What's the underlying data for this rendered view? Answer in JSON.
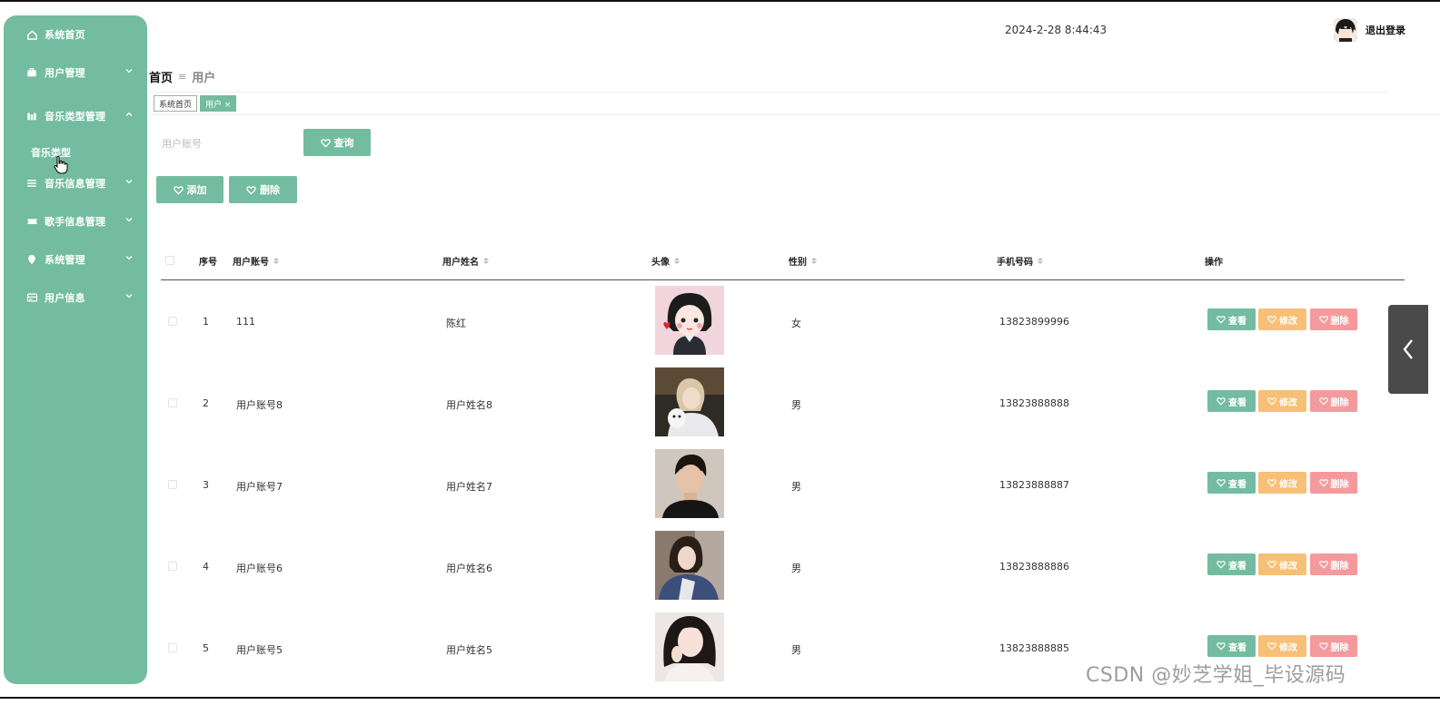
{
  "sidebar": {
    "items": [
      {
        "label": "系统首页",
        "icon": "home-icon"
      },
      {
        "label": "用户管理",
        "icon": "briefcase-icon"
      },
      {
        "label": "音乐类型管理",
        "icon": "bar-chart-icon"
      },
      {
        "label": "音乐信息管理",
        "icon": "list-icon"
      },
      {
        "label": "歌手信息管理",
        "icon": "ticket-icon"
      },
      {
        "label": "系统管理",
        "icon": "location-pin-icon"
      },
      {
        "label": "用户信息",
        "icon": "id-card-icon"
      }
    ],
    "sub_item": "音乐类型"
  },
  "header": {
    "datetime": "2024-2-28 8:44:43",
    "logout": "退出登录"
  },
  "breadcrumb": {
    "home": "首页",
    "separator": "≡",
    "current": "用户"
  },
  "tags": {
    "home": "系统首页",
    "current": "用户 ×"
  },
  "search": {
    "placeholder": "用户账号",
    "query_button": "查询"
  },
  "toolbar": {
    "add": "添加",
    "delete": "删除"
  },
  "table": {
    "columns": [
      "序号",
      "用户账号",
      "用户姓名",
      "头像",
      "性别",
      "手机号码",
      "操作"
    ],
    "rows": [
      {
        "index": "1",
        "account": "111",
        "name": "陈红",
        "gender": "女",
        "phone": "13823899996"
      },
      {
        "index": "2",
        "account": "用户账号8",
        "name": "用户姓名8",
        "gender": "男",
        "phone": "13823888888"
      },
      {
        "index": "3",
        "account": "用户账号7",
        "name": "用户姓名7",
        "gender": "男",
        "phone": "13823888887"
      },
      {
        "index": "4",
        "account": "用户账号6",
        "name": "用户姓名6",
        "gender": "男",
        "phone": "13823888886"
      },
      {
        "index": "5",
        "account": "用户账号5",
        "name": "用户姓名5",
        "gender": "男",
        "phone": "13823888885"
      }
    ],
    "actions": {
      "view": "查看",
      "edit": "修改",
      "delete": "删除"
    }
  },
  "watermark": "CSDN @妙芝学姐_毕设源码",
  "colors": {
    "accent": "#73bca1",
    "edit": "#f8bf76",
    "delete": "#f49a9d"
  }
}
